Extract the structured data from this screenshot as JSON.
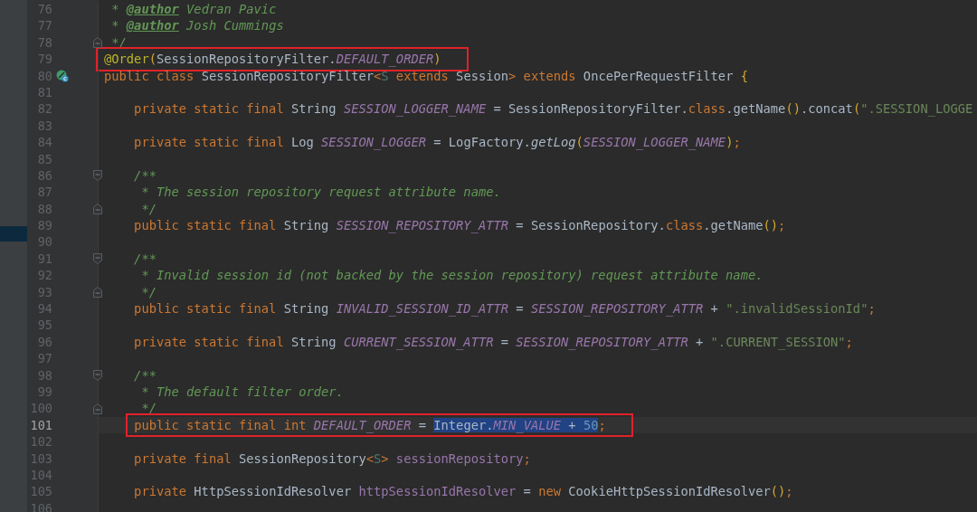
{
  "editor": {
    "lines": [
      {
        "number": "76",
        "current": false,
        "boxed": false,
        "tokens": [
          {
            "kind": "comment",
            "text": " * "
          },
          {
            "kind": "doctag",
            "text": "@author"
          },
          {
            "kind": "comment",
            "text": " Vedran Pavic"
          }
        ]
      },
      {
        "number": "77",
        "current": false,
        "boxed": false,
        "tokens": [
          {
            "kind": "comment",
            "text": " * "
          },
          {
            "kind": "doctag",
            "text": "@author"
          },
          {
            "kind": "comment",
            "text": " Josh Cummings"
          }
        ]
      },
      {
        "number": "78",
        "current": false,
        "boxed": false,
        "gutter_mark": {
          "kind": "fold-end"
        },
        "tokens": [
          {
            "kind": "comment",
            "text": " */"
          }
        ]
      },
      {
        "number": "79",
        "current": false,
        "boxed": true,
        "tokens": [
          {
            "kind": "annotation",
            "text": "@Order"
          },
          {
            "kind": "paren",
            "text": "("
          },
          {
            "kind": "plain",
            "text": "SessionRepositoryFilter."
          },
          {
            "kind": "constant",
            "text": "DEFAULT_ORDER"
          },
          {
            "kind": "paren",
            "text": ")"
          }
        ]
      },
      {
        "number": "80",
        "current": false,
        "boxed": false,
        "gutter_mark": {
          "kind": "class"
        },
        "tokens": [
          {
            "kind": "keyword",
            "text": "public class "
          },
          {
            "kind": "plain",
            "text": "SessionRepositoryFilter"
          },
          {
            "kind": "punct",
            "text": "<"
          },
          {
            "kind": "typeparam",
            "text": "S"
          },
          {
            "kind": "keyword",
            "text": " extends "
          },
          {
            "kind": "plain",
            "text": "Session"
          },
          {
            "kind": "punct",
            "text": ">"
          },
          {
            "kind": "keyword",
            "text": " extends "
          },
          {
            "kind": "plain",
            "text": "OncePerRequestFilter "
          },
          {
            "kind": "paren",
            "text": "{"
          }
        ]
      },
      {
        "number": "81",
        "current": false,
        "boxed": false
      },
      {
        "number": "82",
        "current": false,
        "boxed": false,
        "tokens": [
          {
            "kind": "keyword",
            "text": "    private static final "
          },
          {
            "kind": "plain",
            "text": "String "
          },
          {
            "kind": "constant",
            "text": "SESSION_LOGGER_NAME"
          },
          {
            "kind": "plain",
            "text": " = SessionRepositoryFilter."
          },
          {
            "kind": "keyword",
            "text": "class"
          },
          {
            "kind": "plain",
            "text": ".getName"
          },
          {
            "kind": "paren",
            "text": "()"
          },
          {
            "kind": "plain",
            "text": ".concat"
          },
          {
            "kind": "paren",
            "text": "("
          },
          {
            "kind": "string",
            "text": "\".SESSION_LOGGE"
          }
        ]
      },
      {
        "number": "83",
        "current": false,
        "boxed": false
      },
      {
        "number": "84",
        "current": false,
        "boxed": false,
        "tokens": [
          {
            "kind": "keyword",
            "text": "    private static final "
          },
          {
            "kind": "plain",
            "text": "Log "
          },
          {
            "kind": "constant",
            "text": "SESSION_LOGGER"
          },
          {
            "kind": "plain",
            "text": " = LogFactory."
          },
          {
            "kind": "call",
            "text": "getLog"
          },
          {
            "kind": "paren",
            "text": "("
          },
          {
            "kind": "constant",
            "text": "SESSION_LOGGER_NAME"
          },
          {
            "kind": "paren",
            "text": ")"
          },
          {
            "kind": "punct",
            "text": ";"
          }
        ]
      },
      {
        "number": "85",
        "current": false,
        "boxed": false
      },
      {
        "number": "86",
        "current": false,
        "boxed": false,
        "gutter_mark": {
          "kind": "fold-start"
        },
        "tokens": [
          {
            "kind": "comment",
            "text": "    /**"
          }
        ]
      },
      {
        "number": "87",
        "current": false,
        "boxed": false,
        "tokens": [
          {
            "kind": "comment",
            "text": "     * The session repository request attribute name."
          }
        ]
      },
      {
        "number": "88",
        "current": false,
        "boxed": false,
        "gutter_mark": {
          "kind": "fold-end"
        },
        "tokens": [
          {
            "kind": "comment",
            "text": "     */"
          }
        ]
      },
      {
        "number": "89",
        "current": false,
        "boxed": false,
        "tokens": [
          {
            "kind": "keyword",
            "text": "    public static final "
          },
          {
            "kind": "plain",
            "text": "String "
          },
          {
            "kind": "constant",
            "text": "SESSION_REPOSITORY_ATTR"
          },
          {
            "kind": "plain",
            "text": " = SessionRepository."
          },
          {
            "kind": "keyword",
            "text": "class"
          },
          {
            "kind": "plain",
            "text": ".getName"
          },
          {
            "kind": "paren",
            "text": "()"
          },
          {
            "kind": "punct",
            "text": ";"
          }
        ]
      },
      {
        "number": "90",
        "current": false,
        "boxed": false
      },
      {
        "number": "91",
        "current": false,
        "boxed": false,
        "gutter_mark": {
          "kind": "fold-start"
        },
        "tokens": [
          {
            "kind": "comment",
            "text": "    /**"
          }
        ]
      },
      {
        "number": "92",
        "current": false,
        "boxed": false,
        "tokens": [
          {
            "kind": "comment",
            "text": "     * Invalid session id (not backed by the session repository) request attribute name."
          }
        ]
      },
      {
        "number": "93",
        "current": false,
        "boxed": false,
        "gutter_mark": {
          "kind": "fold-end"
        },
        "tokens": [
          {
            "kind": "comment",
            "text": "     */"
          }
        ]
      },
      {
        "number": "94",
        "current": false,
        "boxed": false,
        "tokens": [
          {
            "kind": "keyword",
            "text": "    public static final "
          },
          {
            "kind": "plain",
            "text": "String "
          },
          {
            "kind": "constant",
            "text": "INVALID_SESSION_ID_ATTR"
          },
          {
            "kind": "plain",
            "text": " = "
          },
          {
            "kind": "constant",
            "text": "SESSION_REPOSITORY_ATTR"
          },
          {
            "kind": "plain",
            "text": " + "
          },
          {
            "kind": "string",
            "text": "\".invalidSessionId\""
          },
          {
            "kind": "punct",
            "text": ";"
          }
        ]
      },
      {
        "number": "95",
        "current": false,
        "boxed": false
      },
      {
        "number": "96",
        "current": false,
        "boxed": false,
        "tokens": [
          {
            "kind": "keyword",
            "text": "    private static final "
          },
          {
            "kind": "plain",
            "text": "String "
          },
          {
            "kind": "constant",
            "text": "CURRENT_SESSION_ATTR"
          },
          {
            "kind": "plain",
            "text": " = "
          },
          {
            "kind": "constant",
            "text": "SESSION_REPOSITORY_ATTR"
          },
          {
            "kind": "plain",
            "text": " + "
          },
          {
            "kind": "string",
            "text": "\".CURRENT_SESSION\""
          },
          {
            "kind": "punct",
            "text": ";"
          }
        ]
      },
      {
        "number": "97",
        "current": false,
        "boxed": false
      },
      {
        "number": "98",
        "current": false,
        "boxed": false,
        "gutter_mark": {
          "kind": "fold-start"
        },
        "tokens": [
          {
            "kind": "comment",
            "text": "    /**"
          }
        ]
      },
      {
        "number": "99",
        "current": false,
        "boxed": false,
        "tokens": [
          {
            "kind": "comment",
            "text": "     * The default filter order."
          }
        ]
      },
      {
        "number": "100",
        "current": false,
        "boxed": false,
        "gutter_mark": {
          "kind": "fold-end"
        },
        "tokens": [
          {
            "kind": "comment",
            "text": "     */"
          }
        ]
      },
      {
        "number": "101",
        "current": true,
        "boxed": true,
        "tokens": [
          {
            "kind": "keyword",
            "text": "    public static final int "
          },
          {
            "kind": "constant",
            "text": "DEFAULT_ORDER"
          },
          {
            "kind": "plain",
            "text": " = "
          }
        ],
        "selection": [
          {
            "kind": "plain",
            "text": "Integer."
          },
          {
            "kind": "constant",
            "text": "MIN_VALUE"
          },
          {
            "kind": "plain",
            "text": " + "
          },
          {
            "kind": "number",
            "text": "50"
          }
        ],
        "after": [
          {
            "kind": "punct",
            "text": ";"
          }
        ]
      },
      {
        "number": "102",
        "current": false,
        "boxed": false
      },
      {
        "number": "103",
        "current": false,
        "boxed": false,
        "tokens": [
          {
            "kind": "keyword",
            "text": "    private final "
          },
          {
            "kind": "plain",
            "text": "SessionRepository"
          },
          {
            "kind": "punct",
            "text": "<"
          },
          {
            "kind": "typeparam",
            "text": "S"
          },
          {
            "kind": "punct",
            "text": ">"
          },
          {
            "kind": "field",
            "text": " sessionRepository"
          },
          {
            "kind": "punct",
            "text": ";"
          }
        ]
      },
      {
        "number": "104",
        "current": false,
        "boxed": false
      },
      {
        "number": "105",
        "current": false,
        "boxed": false,
        "tokens": [
          {
            "kind": "keyword",
            "text": "    private "
          },
          {
            "kind": "plain",
            "text": "HttpSessionIdResolver "
          },
          {
            "kind": "field",
            "text": "httpSessionIdResolver"
          },
          {
            "kind": "plain",
            "text": " = "
          },
          {
            "kind": "keyword",
            "text": "new "
          },
          {
            "kind": "plain",
            "text": "CookieHttpSessionIdResolver"
          },
          {
            "kind": "paren",
            "text": "()"
          },
          {
            "kind": "punct",
            "text": ";"
          }
        ]
      },
      {
        "number": "106",
        "current": false,
        "boxed": false
      }
    ]
  }
}
